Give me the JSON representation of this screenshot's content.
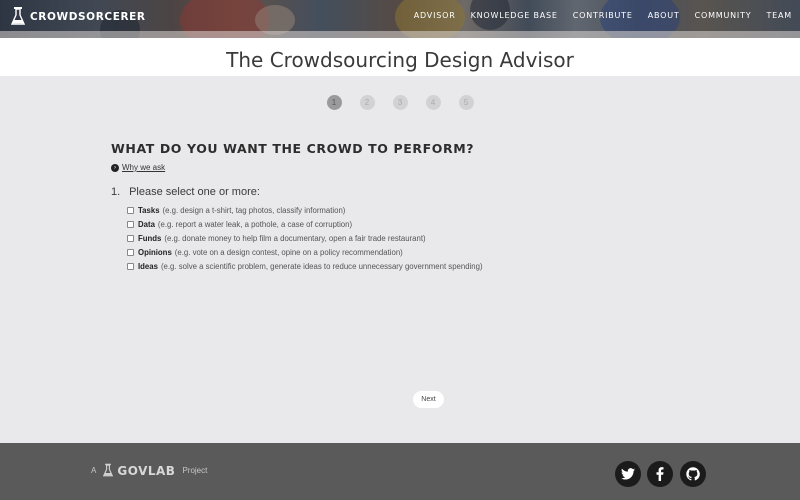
{
  "header": {
    "brand": "CROWDSORCERER",
    "nav": [
      "ADVISOR",
      "KNOWLEDGE BASE",
      "CONTRIBUTE",
      "ABOUT",
      "COMMUNITY",
      "TEAM"
    ]
  },
  "page_title": "The Crowdsourcing Design Advisor",
  "steps": [
    "1",
    "2",
    "3",
    "4",
    "5"
  ],
  "active_step": "1",
  "question": {
    "heading": "WHAT DO YOU WANT THE CROWD TO PERFORM?",
    "why_link": "Why we ask",
    "number": "1.",
    "prompt": "Please select one or more:",
    "options": [
      {
        "label": "Tasks",
        "hint": "(e.g. design a t-shirt, tag photos, classify information)"
      },
      {
        "label": "Data",
        "hint": "(e.g. report a water leak, a pothole, a case of corruption)"
      },
      {
        "label": "Funds",
        "hint": "(e.g. donate money to help film a documentary, open a fair trade restaurant)"
      },
      {
        "label": "Opinions",
        "hint": "(e.g. vote on a design contest, opine on a policy recommendation)"
      },
      {
        "label": "Ideas",
        "hint": "(e.g. solve a scientific problem, generate ideas to reduce unnecessary government spending)"
      }
    ]
  },
  "next_label": "Next",
  "footer": {
    "prefix": "A",
    "org": "GOVLAB",
    "suffix": "Project",
    "social_icons": [
      "twitter-icon",
      "facebook-icon",
      "github-icon"
    ]
  },
  "colors": {
    "page_bg": "#e9e9eb",
    "footer_bg": "#5a5a5a",
    "active_step": "#9a9a9c",
    "inactive_step": "#d2d2d4"
  }
}
